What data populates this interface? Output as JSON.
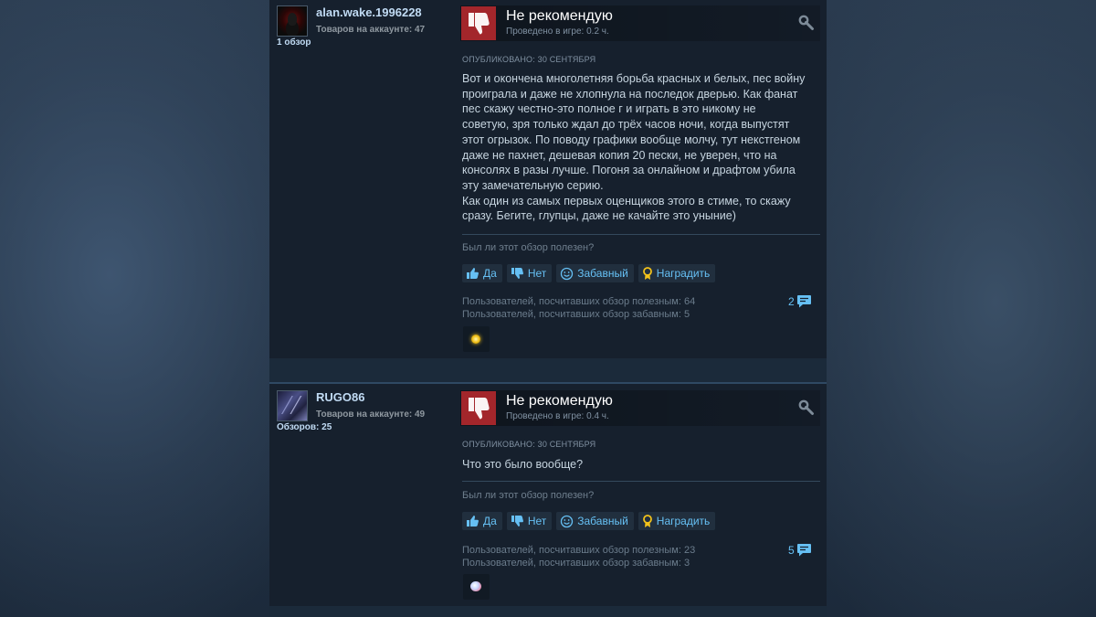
{
  "reviews": [
    {
      "persona": "alan.wake.1996228",
      "products": "Товаров на аккаунте: 47",
      "reviews_count": "1 обзор",
      "verdict": "Не рекомендую",
      "hours": "Проведено в игре: 0.2 ч.",
      "posted": "Опубликовано: 30 сентября",
      "body": "Вот и окончена многолетняя борьба красных и белых, пес войну\nпроиграла и даже не хлопнула на последок дверью. Как фанат\nпес скажу честно-это полное г и играть в это никому не\nсоветую, зря только ждал до трёх часов ночи, когда выпустят\nэтот огрызок. По поводу графики вообще молчу, тут некстгеном\nдаже не пахнет, дешевая копия 20 пески, не уверен, что на\nконсолях в разы лучше. Погоня за онлайном и драфтом убила\nэту замечательную серию.\nКак один из самых первых оценщиков этого в стиме, то скажу\nсразу. Бегите, глупцы, даже не качайте это уныние)",
      "helpful_question": "Был ли этот обзор полезен?",
      "buttons": {
        "yes": "Да",
        "no": "Нет",
        "funny": "Забавный",
        "award": "Наградить"
      },
      "stat_helpful": "Пользователей, посчитавших обзор полезным: 64",
      "stat_funny": "Пользователей, посчитавших обзор забавным: 5",
      "comments": "2",
      "award_icon": "gold-coin-award-icon"
    },
    {
      "persona": "RUGO86",
      "products": "Товаров на аккаунте: 49",
      "reviews_count": "Обзоров: 25",
      "verdict": "Не рекомендую",
      "hours": "Проведено в игре: 0.4 ч.",
      "posted": "Опубликовано: 30 сентября",
      "body": "Что это было вообще?",
      "helpful_question": "Был ли этот обзор полезен?",
      "buttons": {
        "yes": "Да",
        "no": "Нет",
        "funny": "Забавный",
        "award": "Наградить"
      },
      "stat_helpful": "Пользователей, посчитавших обзор полезным: 23",
      "stat_funny": "Пользователей, посчитавших обзор забавным: 3",
      "comments": "5",
      "award_icon": "puff-award-icon"
    }
  ],
  "colors": {
    "not_recommended": "#a3262b",
    "link": "#66c0f4",
    "persona": "#c1dbf4",
    "text": "#c6d4df"
  }
}
